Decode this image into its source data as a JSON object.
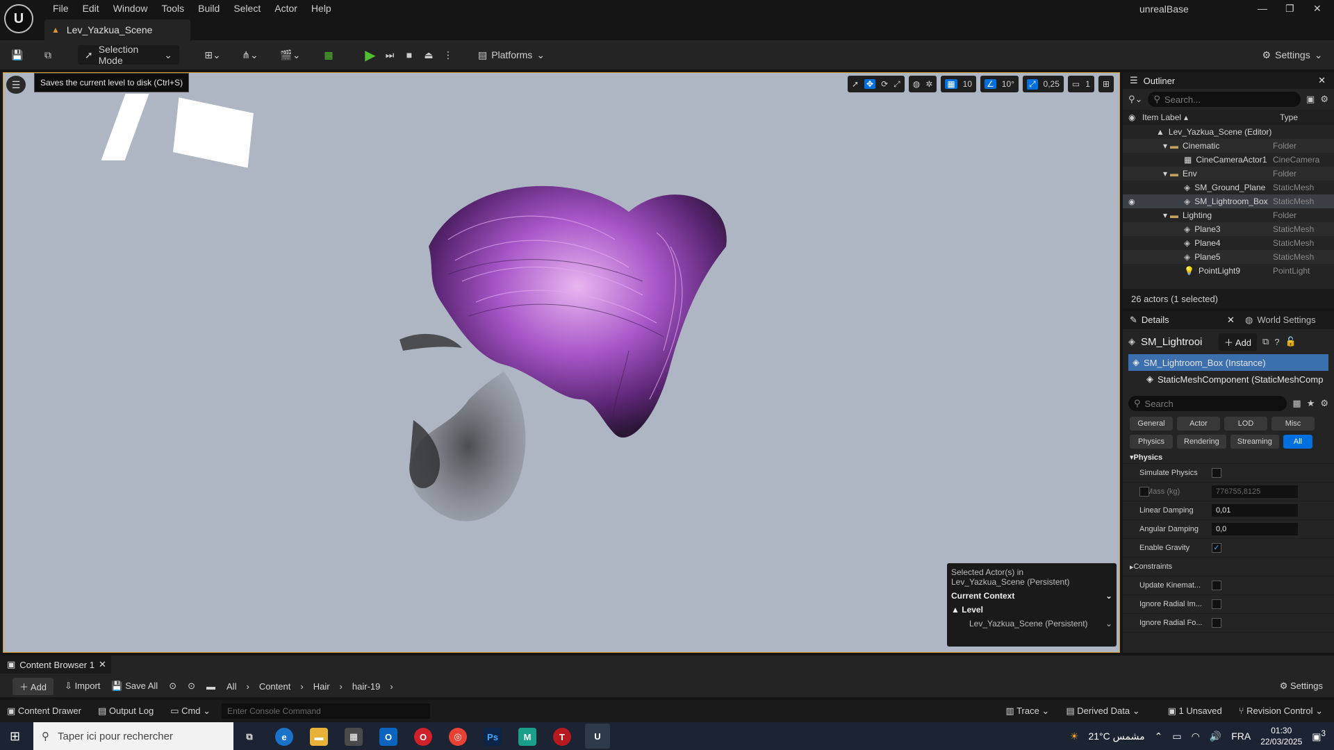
{
  "menubar": {
    "items": [
      "File",
      "Edit",
      "Window",
      "Tools",
      "Build",
      "Select",
      "Actor",
      "Help"
    ],
    "project_name": "unrealBase",
    "logo_text": "U"
  },
  "level_tab": {
    "title": "Lev_Yazkua_Scene"
  },
  "toolbar": {
    "selection_mode": "Selection Mode",
    "platforms": "Platforms",
    "settings": "Settings"
  },
  "viewport": {
    "tooltip": "Saves the current level to disk (Ctrl+S)",
    "grid_snap": "10",
    "rotation_snap": "10°",
    "scale_snap": "0,25",
    "camera_speed": "1"
  },
  "context": {
    "selected_line1": "Selected Actor(s) in",
    "selected_line2": "Lev_Yazkua_Scene (Persistent)",
    "current_context": "Current Context",
    "level_label": "Level",
    "level_value": "Lev_Yazkua_Scene (Persistent)"
  },
  "outliner": {
    "title": "Outliner",
    "search_placeholder": "Search...",
    "col_label": "Item Label",
    "col_type": "Type",
    "rows": [
      {
        "label": "Lev_Yazkua_Scene (Editor)",
        "type": "",
        "indent": 0
      },
      {
        "label": "Cinematic",
        "type": "Folder",
        "indent": 1
      },
      {
        "label": "CineCameraActor1",
        "type": "CineCamera",
        "indent": 2
      },
      {
        "label": "Env",
        "type": "Folder",
        "indent": 1
      },
      {
        "label": "SM_Ground_Plane",
        "type": "StaticMesh",
        "indent": 2
      },
      {
        "label": "SM_Lightroom_Box",
        "type": "StaticMesh",
        "indent": 2
      },
      {
        "label": "Lighting",
        "type": "Folder",
        "indent": 1
      },
      {
        "label": "Plane3",
        "type": "StaticMesh",
        "indent": 2
      },
      {
        "label": "Plane4",
        "type": "StaticMesh",
        "indent": 2
      },
      {
        "label": "Plane5",
        "type": "StaticMesh",
        "indent": 2
      },
      {
        "label": "PointLight9",
        "type": "PointLight",
        "indent": 2
      }
    ],
    "footer": "26 actors (1 selected)"
  },
  "details": {
    "tab_details": "Details",
    "tab_world": "World Settings",
    "actor_name": "SM_Lightrooi",
    "add_label": "Add",
    "instance_label": "SM_Lightroom_Box (Instance)",
    "component_label": "StaticMeshComponent (StaticMeshComp",
    "search_placeholder": "Search",
    "filters": [
      "General",
      "Actor",
      "LOD",
      "Misc",
      "Physics",
      "Rendering",
      "Streaming",
      "All"
    ],
    "section": "Physics",
    "props": [
      {
        "label": "Simulate Physics",
        "kind": "check",
        "value": ""
      },
      {
        "label": "Mass (kg)",
        "kind": "disabled",
        "value": "776755,8125"
      },
      {
        "label": "Linear Damping",
        "kind": "value",
        "value": "0,01"
      },
      {
        "label": "Angular Damping",
        "kind": "value",
        "value": "0,0"
      },
      {
        "label": "Enable Gravity",
        "kind": "checked",
        "value": ""
      },
      {
        "label": "Constraints",
        "kind": "section",
        "value": ""
      },
      {
        "label": "Update Kinemat...",
        "kind": "check",
        "value": ""
      },
      {
        "label": "Ignore Radial Im...",
        "kind": "check",
        "value": ""
      },
      {
        "label": "Ignore Radial Fo...",
        "kind": "check",
        "value": ""
      }
    ]
  },
  "content_browser": {
    "tab": "Content Browser 1",
    "add": "Add",
    "import": "Import",
    "save_all": "Save All",
    "breadcrumb": [
      "All",
      "Content",
      "Hair",
      "hair-19"
    ],
    "settings": "Settings"
  },
  "bottom_bar": {
    "content_drawer": "Content Drawer",
    "output_log": "Output Log",
    "cmd": "Cmd",
    "console_placeholder": "Enter Console Command",
    "trace": "Trace",
    "derived_data": "Derived Data",
    "unsaved": "1 Unsaved",
    "revision_control": "Revision Control"
  },
  "taskbar": {
    "search_placeholder": "Taper ici pour rechercher",
    "weather": "21°C  مشمس",
    "lang": "FRA",
    "time": "01:30",
    "date": "22/03/2025",
    "notif_count": "3"
  }
}
